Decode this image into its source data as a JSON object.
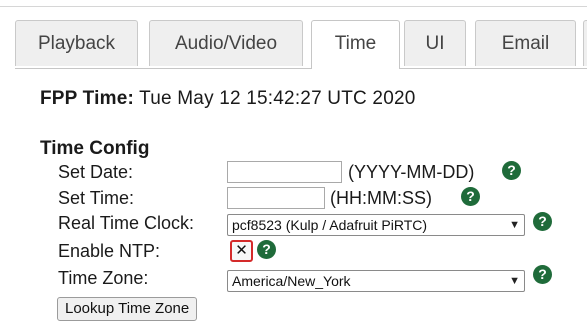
{
  "tabs": [
    {
      "label": "Playback"
    },
    {
      "label": "Audio/Video"
    },
    {
      "label": "Time"
    },
    {
      "label": "UI"
    },
    {
      "label": "Email"
    }
  ],
  "active_tab": "Time",
  "fpp_time": {
    "label": "FPP Time:",
    "value": "Tue May 12 15:42:27 UTC 2020"
  },
  "time_config": {
    "title": "Time Config",
    "set_date": {
      "label": "Set Date:",
      "value": "",
      "hint": "(YYYY-MM-DD)"
    },
    "set_time": {
      "label": "Set Time:",
      "value": "",
      "hint": "(HH:MM:SS)"
    },
    "rtc": {
      "label": "Real Time Clock:",
      "selected": "pcf8523 (Kulp / Adafruit PiRTC)"
    },
    "ntp": {
      "label": "Enable NTP:",
      "checked": true,
      "check_glyph": "✕"
    },
    "timezone": {
      "label": "Time Zone:",
      "selected": "America/New_York"
    },
    "lookup_button": "Lookup Time Zone"
  },
  "help_glyph": "?",
  "colors": {
    "help_icon": "#1f6b3a",
    "ntp_highlight": "#d42a2a"
  }
}
